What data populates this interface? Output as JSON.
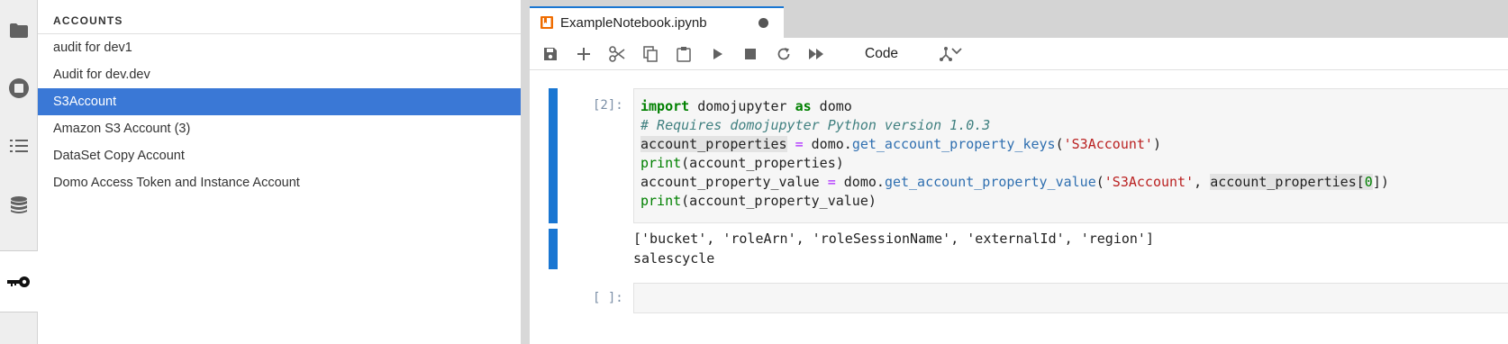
{
  "activity_bar": {
    "icons": [
      "folder-icon",
      "stop-circle-icon",
      "list-icon",
      "database-icon",
      "key-icon"
    ]
  },
  "accounts": {
    "title": "ACCOUNTS",
    "items": [
      {
        "label": "audit for dev1",
        "selected": false
      },
      {
        "label": "Audit for dev.dev",
        "selected": false
      },
      {
        "label": "S3Account",
        "selected": true
      },
      {
        "label": "Amazon S3 Account (3)",
        "selected": false
      },
      {
        "label": "DataSet Copy Account",
        "selected": false
      },
      {
        "label": "Domo Access Token and Instance Account",
        "selected": false
      }
    ]
  },
  "notebook": {
    "tab_title": "ExampleNotebook.ipynb",
    "unsaved_indicator": "modified-dot-icon",
    "toolbar": {
      "buttons": [
        "save-icon",
        "add-cell-icon",
        "cut-icon",
        "copy-icon",
        "paste-icon",
        "run-icon",
        "stop-icon",
        "restart-icon",
        "run-all-icon",
        "git-icon"
      ],
      "cell_type": "Code"
    },
    "cells": [
      {
        "prompt": "[2]:",
        "code": {
          "line1": {
            "kw": "import",
            "mid": " domojupyter ",
            "kw2": "as",
            "end": " domo"
          },
          "line2": "# Requires domojupyter Python version 1.0.3",
          "line3": {
            "var": "account_properties",
            "eq": " = ",
            "obj": "domo.",
            "fn": "get_account_property_keys",
            "open": "(",
            "str": "'S3Account'",
            "close": ")"
          },
          "line4": {
            "fn": "print",
            "args": "(account_properties)"
          },
          "line5": {
            "var": "account_property_value",
            "eq": " = ",
            "obj": "domo.",
            "fn": "get_account_property_value",
            "open": "(",
            "str": "'S3Account'",
            "comma": ", ",
            "arg": "account_properties[",
            "num": "0",
            "close": "])"
          },
          "line6": {
            "fn": "print",
            "args": "(account_property_value)"
          }
        },
        "output": [
          "['bucket', 'roleArn', 'roleSessionName', 'externalId', 'region']",
          "salescycle"
        ]
      },
      {
        "prompt": "[ ]:",
        "code": ""
      }
    ]
  },
  "colors": {
    "accent": "#1976d2",
    "selection": "#3a78d6"
  }
}
